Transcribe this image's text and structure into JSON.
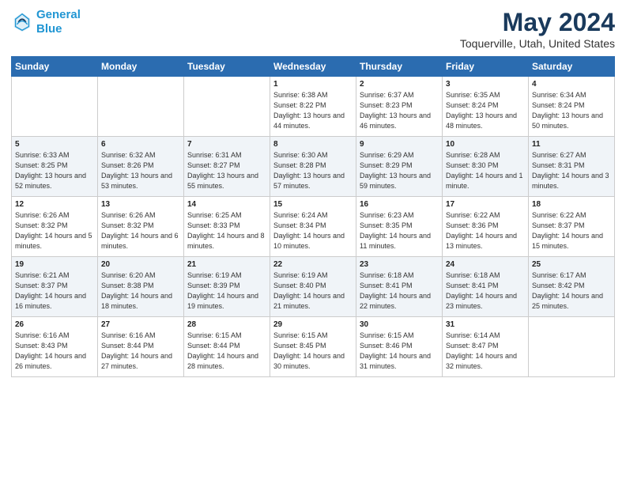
{
  "header": {
    "logo_line1": "General",
    "logo_line2": "Blue",
    "title": "May 2024",
    "subtitle": "Toquerville, Utah, United States"
  },
  "calendar": {
    "headers": [
      "Sunday",
      "Monday",
      "Tuesday",
      "Wednesday",
      "Thursday",
      "Friday",
      "Saturday"
    ],
    "rows": [
      [
        {
          "day": "",
          "info": ""
        },
        {
          "day": "",
          "info": ""
        },
        {
          "day": "",
          "info": ""
        },
        {
          "day": "1",
          "info": "Sunrise: 6:38 AM\nSunset: 8:22 PM\nDaylight: 13 hours and 44 minutes."
        },
        {
          "day": "2",
          "info": "Sunrise: 6:37 AM\nSunset: 8:23 PM\nDaylight: 13 hours and 46 minutes."
        },
        {
          "day": "3",
          "info": "Sunrise: 6:35 AM\nSunset: 8:24 PM\nDaylight: 13 hours and 48 minutes."
        },
        {
          "day": "4",
          "info": "Sunrise: 6:34 AM\nSunset: 8:24 PM\nDaylight: 13 hours and 50 minutes."
        }
      ],
      [
        {
          "day": "5",
          "info": "Sunrise: 6:33 AM\nSunset: 8:25 PM\nDaylight: 13 hours and 52 minutes."
        },
        {
          "day": "6",
          "info": "Sunrise: 6:32 AM\nSunset: 8:26 PM\nDaylight: 13 hours and 53 minutes."
        },
        {
          "day": "7",
          "info": "Sunrise: 6:31 AM\nSunset: 8:27 PM\nDaylight: 13 hours and 55 minutes."
        },
        {
          "day": "8",
          "info": "Sunrise: 6:30 AM\nSunset: 8:28 PM\nDaylight: 13 hours and 57 minutes."
        },
        {
          "day": "9",
          "info": "Sunrise: 6:29 AM\nSunset: 8:29 PM\nDaylight: 13 hours and 59 minutes."
        },
        {
          "day": "10",
          "info": "Sunrise: 6:28 AM\nSunset: 8:30 PM\nDaylight: 14 hours and 1 minute."
        },
        {
          "day": "11",
          "info": "Sunrise: 6:27 AM\nSunset: 8:31 PM\nDaylight: 14 hours and 3 minutes."
        }
      ],
      [
        {
          "day": "12",
          "info": "Sunrise: 6:26 AM\nSunset: 8:32 PM\nDaylight: 14 hours and 5 minutes."
        },
        {
          "day": "13",
          "info": "Sunrise: 6:26 AM\nSunset: 8:32 PM\nDaylight: 14 hours and 6 minutes."
        },
        {
          "day": "14",
          "info": "Sunrise: 6:25 AM\nSunset: 8:33 PM\nDaylight: 14 hours and 8 minutes."
        },
        {
          "day": "15",
          "info": "Sunrise: 6:24 AM\nSunset: 8:34 PM\nDaylight: 14 hours and 10 minutes."
        },
        {
          "day": "16",
          "info": "Sunrise: 6:23 AM\nSunset: 8:35 PM\nDaylight: 14 hours and 11 minutes."
        },
        {
          "day": "17",
          "info": "Sunrise: 6:22 AM\nSunset: 8:36 PM\nDaylight: 14 hours and 13 minutes."
        },
        {
          "day": "18",
          "info": "Sunrise: 6:22 AM\nSunset: 8:37 PM\nDaylight: 14 hours and 15 minutes."
        }
      ],
      [
        {
          "day": "19",
          "info": "Sunrise: 6:21 AM\nSunset: 8:37 PM\nDaylight: 14 hours and 16 minutes."
        },
        {
          "day": "20",
          "info": "Sunrise: 6:20 AM\nSunset: 8:38 PM\nDaylight: 14 hours and 18 minutes."
        },
        {
          "day": "21",
          "info": "Sunrise: 6:19 AM\nSunset: 8:39 PM\nDaylight: 14 hours and 19 minutes."
        },
        {
          "day": "22",
          "info": "Sunrise: 6:19 AM\nSunset: 8:40 PM\nDaylight: 14 hours and 21 minutes."
        },
        {
          "day": "23",
          "info": "Sunrise: 6:18 AM\nSunset: 8:41 PM\nDaylight: 14 hours and 22 minutes."
        },
        {
          "day": "24",
          "info": "Sunrise: 6:18 AM\nSunset: 8:41 PM\nDaylight: 14 hours and 23 minutes."
        },
        {
          "day": "25",
          "info": "Sunrise: 6:17 AM\nSunset: 8:42 PM\nDaylight: 14 hours and 25 minutes."
        }
      ],
      [
        {
          "day": "26",
          "info": "Sunrise: 6:16 AM\nSunset: 8:43 PM\nDaylight: 14 hours and 26 minutes."
        },
        {
          "day": "27",
          "info": "Sunrise: 6:16 AM\nSunset: 8:44 PM\nDaylight: 14 hours and 27 minutes."
        },
        {
          "day": "28",
          "info": "Sunrise: 6:15 AM\nSunset: 8:44 PM\nDaylight: 14 hours and 28 minutes."
        },
        {
          "day": "29",
          "info": "Sunrise: 6:15 AM\nSunset: 8:45 PM\nDaylight: 14 hours and 30 minutes."
        },
        {
          "day": "30",
          "info": "Sunrise: 6:15 AM\nSunset: 8:46 PM\nDaylight: 14 hours and 31 minutes."
        },
        {
          "day": "31",
          "info": "Sunrise: 6:14 AM\nSunset: 8:47 PM\nDaylight: 14 hours and 32 minutes."
        },
        {
          "day": "",
          "info": ""
        }
      ]
    ]
  }
}
